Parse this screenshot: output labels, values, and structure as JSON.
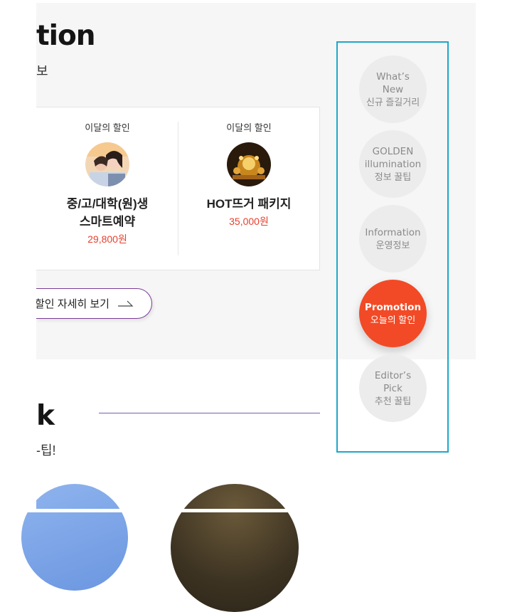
{
  "promotion": {
    "title": "tion",
    "subtitle": "보",
    "items": [
      {
        "tag": "이달의 할인",
        "name_line1": "중/고/대학(원)생",
        "name_line2": "스마트예약",
        "price": "29,800원"
      },
      {
        "tag": "이달의 할인",
        "name_line1": "HOT뜨거 패키지",
        "name_line2": "",
        "price": "35,000원"
      }
    ],
    "detail_button": {
      "label": "할인 자세히 보기",
      "arrow": "→"
    }
  },
  "editors": {
    "title": "k",
    "subtitle": "-팁!"
  },
  "side_nav": {
    "items": [
      {
        "en": "What’s New",
        "ko": "신규 즐길거리",
        "active": false
      },
      {
        "en": "GOLDEN illumination",
        "ko": "정보 꿀팁",
        "active": false
      },
      {
        "en": "Information",
        "ko": "운영정보",
        "active": false
      },
      {
        "en": "Promotion",
        "ko": "오늘의 할인",
        "active": true
      },
      {
        "en": "Editor’s Pick",
        "ko": "추천 꿀팁",
        "active": false
      }
    ]
  },
  "colors": {
    "accent": "#f24a26",
    "price": "#e8402d",
    "nav_border": "#1ea7c9",
    "button_border": "#7b3a96"
  }
}
